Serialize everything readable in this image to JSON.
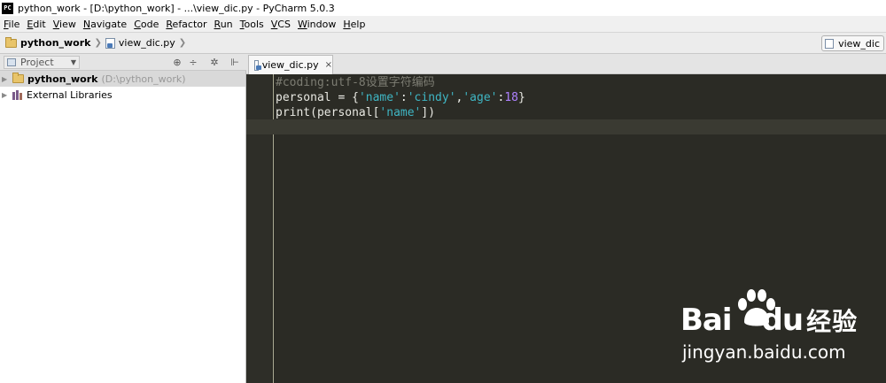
{
  "window": {
    "title": "python_work - [D:\\python_work] - ...\\view_dic.py - PyCharm 5.0.3",
    "app_icon_text": "PC"
  },
  "menu": [
    {
      "mnemonic": "F",
      "rest": "ile"
    },
    {
      "mnemonic": "E",
      "rest": "dit"
    },
    {
      "mnemonic": "V",
      "rest": "iew"
    },
    {
      "mnemonic": "N",
      "rest": "avigate"
    },
    {
      "mnemonic": "C",
      "rest": "ode"
    },
    {
      "mnemonic": "R",
      "rest": "efactor"
    },
    {
      "mnemonic": "R",
      "rest": "un"
    },
    {
      "mnemonic": "T",
      "rest": "ools"
    },
    {
      "mnemonic": "V",
      "rest": "CS"
    },
    {
      "mnemonic": "W",
      "rest": "indow"
    },
    {
      "mnemonic": "H",
      "rest": "elp"
    }
  ],
  "navbar": {
    "project": "python_work",
    "file": "view_dic.py",
    "run_config": "view_dic"
  },
  "project_panel": {
    "selector_label": "Project",
    "tools": [
      "⊕",
      "÷",
      "✲",
      "⊩"
    ],
    "tree": [
      {
        "label": "python_work",
        "path": "(D:\\python_work)"
      },
      {
        "label": "External Libraries"
      }
    ]
  },
  "editor": {
    "tab_label": "view_dic.py",
    "tab_close": "×",
    "lines": [
      [
        {
          "t": "#coding:utf-8设置字符编码",
          "c": "comment"
        }
      ],
      [
        {
          "t": "personal ",
          "c": "plain"
        },
        {
          "t": "=",
          "c": "op"
        },
        {
          "t": " {",
          "c": "plain"
        },
        {
          "t": "'name'",
          "c": "str"
        },
        {
          "t": ":",
          "c": "op"
        },
        {
          "t": "'cindy'",
          "c": "str"
        },
        {
          "t": ",",
          "c": "op"
        },
        {
          "t": "'age'",
          "c": "str"
        },
        {
          "t": ":",
          "c": "op"
        },
        {
          "t": "18",
          "c": "num"
        },
        {
          "t": "}",
          "c": "plain"
        }
      ],
      [
        {
          "t": "print",
          "c": "fn"
        },
        {
          "t": "(personal[",
          "c": "plain"
        },
        {
          "t": "'name'",
          "c": "str"
        },
        {
          "t": "])",
          "c": "plain"
        }
      ]
    ]
  },
  "watermark": {
    "logo_latin": "Bai",
    "logo_du": "du",
    "logo_cn": "经验",
    "url": "jingyan.baidu.com"
  }
}
